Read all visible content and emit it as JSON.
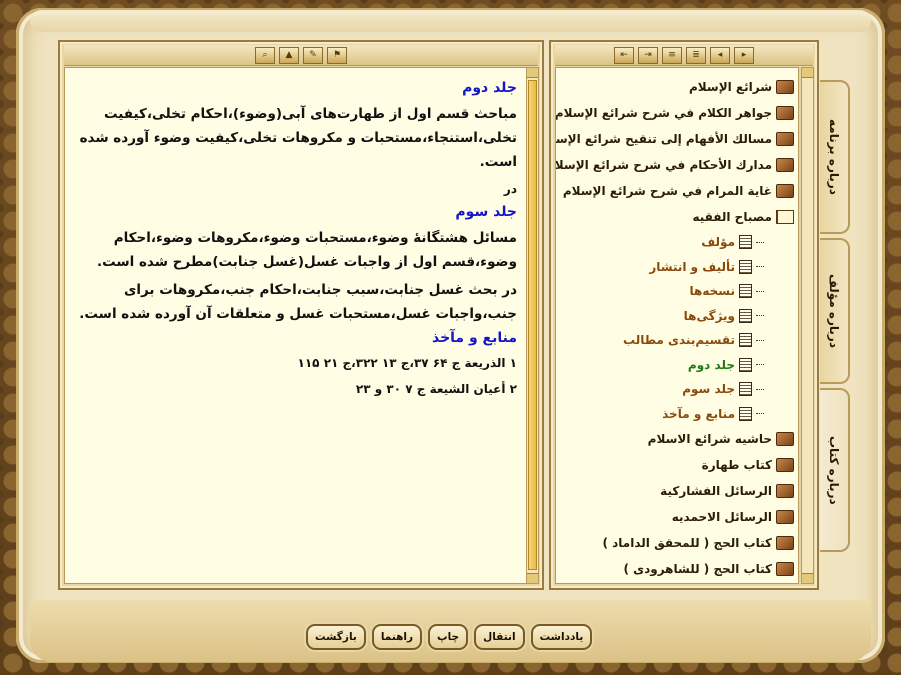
{
  "left_panel": {
    "toolbar_icons": [
      "binoculars-icon",
      "search-icon",
      "highlight-icon",
      "bookmark-icon"
    ],
    "paragraphs": [
      {
        "type": "heading",
        "text": "جلد دوم"
      },
      {
        "type": "para",
        "text": "مباحث قسم اول از طهارت‌های آبی(وضوء)،احکام تخلی،کیفیت تخلی،استنجاء،مستحبات و مکروهات تخلی،کیفیت وضوء آورده شده است."
      },
      {
        "type": "small",
        "text": "در"
      },
      {
        "type": "heading",
        "text": "جلد سوم"
      },
      {
        "type": "para",
        "text": "مسائل هشتگانهٔ وضوء،مستحبات وضوء،مکروهات وضوء،احکام وضوء،قسم اول از واجبات غسل(غسل جنابت)مطرح شده است."
      },
      {
        "type": "para",
        "text": "در بحث غسل جنابت،سبب جنابت،احکام جنب،مکروهات برای جنب،واجبات غسل،مستحبات غسل و متعلقات آن آورده شده است."
      },
      {
        "type": "heading",
        "text": "منابع و مآخذ"
      },
      {
        "type": "small",
        "text": "۱ الذریعة ج ۶۴ ۳۷،ج ۱۳ ۳۲۲،ج ۲۱ ۱۱۵"
      },
      {
        "type": "small",
        "text": "۲ أعیان الشیعة ج ۷ ۳۰ و ۲۳"
      }
    ]
  },
  "right_panel": {
    "toolbar_icons": [
      "expand-icon",
      "collapse-icon",
      "list-icon",
      "sort-icon",
      "prev-icon",
      "next-icon"
    ],
    "tree": [
      {
        "label": "شرائع الإسلام",
        "icon": "book-icon"
      },
      {
        "label": "جواهر الكلام في شرح شرائع الإسلام",
        "icon": "book-icon"
      },
      {
        "label": "مسالك الأفهام إلى تنقيح شرائع الإسلام",
        "icon": "book-icon"
      },
      {
        "label": "مدارك الأحكام في شرح شرائع الإسلام",
        "icon": "book-icon"
      },
      {
        "label": "غاية المرام في شرح شرائع الإسلام",
        "icon": "book-icon"
      },
      {
        "label": "مصباح الفقيه",
        "icon": "open-book-icon",
        "children": [
          {
            "label": "مؤلف",
            "color": "#8b4a0c"
          },
          {
            "label": "تألیف و انتشار",
            "color": "#8b4a0c"
          },
          {
            "label": "نسخه‌ها",
            "color": "#8b4a0c"
          },
          {
            "label": "ویژگی‌ها",
            "color": "#8b4a0c"
          },
          {
            "label": "تقسیم‌بندی مطالب",
            "color": "#8b4a0c"
          },
          {
            "label": "جلد دوم",
            "color": "#1e7a12"
          },
          {
            "label": "جلد سوم",
            "color": "#8b4a0c"
          },
          {
            "label": "منابع و مآخذ",
            "color": "#8b4a0c"
          }
        ]
      },
      {
        "label": "حاشیه شرائع الاسلام",
        "icon": "book-icon"
      },
      {
        "label": "کتاب طهارة",
        "icon": "book-icon"
      },
      {
        "label": "الرسائل الفشارکية",
        "icon": "book-icon"
      },
      {
        "label": "الرسائل الاحمدیه",
        "icon": "book-icon"
      },
      {
        "label": "کتاب الحج ( للمحقق الداماد )",
        "icon": "book-icon"
      },
      {
        "label": "کتاب الحج ( للشاهرودی )",
        "icon": "book-icon"
      }
    ]
  },
  "side_tabs": [
    {
      "label": "درباره برنامه"
    },
    {
      "label": "درباره مؤلف"
    },
    {
      "label": "درباره کتاب"
    }
  ],
  "bottom_buttons": [
    {
      "name": "back-button",
      "label": "بازگشت"
    },
    {
      "name": "help-button",
      "label": "راهنما"
    },
    {
      "name": "print-button",
      "label": "چاپ"
    },
    {
      "name": "transfer-button",
      "label": "انتقال"
    },
    {
      "name": "note-button",
      "label": "یادداشت"
    }
  ],
  "colors": {
    "heading": "#1414c8",
    "selected": "#1e7a12",
    "child": "#8b4a0c"
  }
}
